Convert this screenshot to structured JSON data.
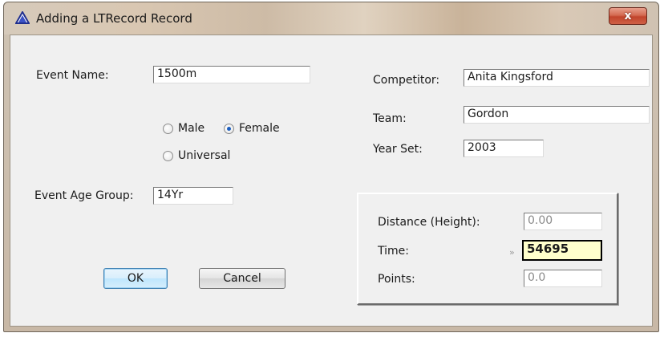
{
  "window": {
    "title": "Adding a LTRecord Record",
    "close_label": "x"
  },
  "form": {
    "event_name_label": "Event Name:",
    "event_name_value": "1500m",
    "gender": {
      "male_label": "Male",
      "female_label": "Female",
      "universal_label": "Universal",
      "selected": "Female"
    },
    "event_age_group_label": "Event Age Group:",
    "event_age_group_value": "14Yr",
    "competitor_label": "Competitor:",
    "competitor_value": "Anita Kingsford",
    "team_label": "Team:",
    "team_value": "Gordon",
    "year_set_label": "Year Set:",
    "year_set_value": "2003"
  },
  "result_panel": {
    "distance_label": "Distance (Height):",
    "distance_value": "0.00",
    "time_label": "Time:",
    "time_marker": "»",
    "time_value": "54695",
    "points_label": "Points:",
    "points_value": "0.0"
  },
  "buttons": {
    "ok_label": "OK",
    "cancel_label": "Cancel"
  },
  "colors": {
    "time_field_bg": "#ffffcc",
    "default_button_border": "#3c7fb1",
    "close_button": "#c1452c"
  }
}
